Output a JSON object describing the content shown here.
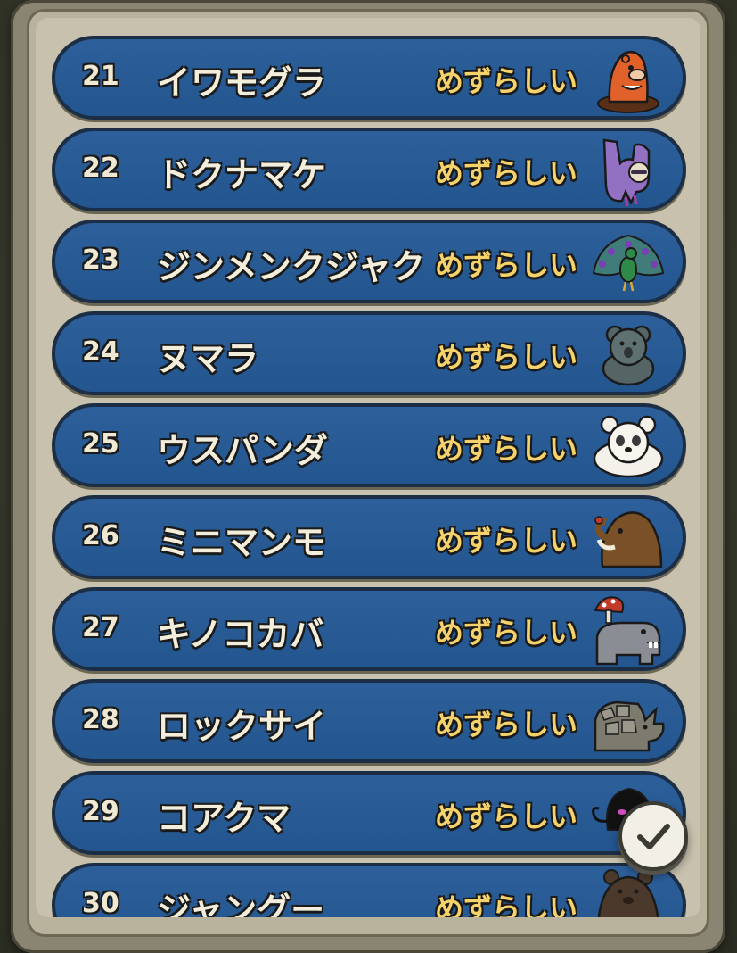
{
  "list": {
    "items": [
      {
        "number": "21",
        "name": "イワモグラ",
        "rarity": "めずらしい",
        "icon": "mole-icon"
      },
      {
        "number": "22",
        "name": "ドクナマケ",
        "rarity": "めずらしい",
        "icon": "sloth-icon"
      },
      {
        "number": "23",
        "name": "ジンメンクジャク",
        "rarity": "めずらしい",
        "icon": "peacock-icon"
      },
      {
        "number": "24",
        "name": "ヌマラ",
        "rarity": "めずらしい",
        "icon": "koala-icon"
      },
      {
        "number": "25",
        "name": "ウスパンダ",
        "rarity": "めずらしい",
        "icon": "panda-icon"
      },
      {
        "number": "26",
        "name": "ミニマンモ",
        "rarity": "めずらしい",
        "icon": "mammoth-icon"
      },
      {
        "number": "27",
        "name": "キノコカバ",
        "rarity": "めずらしい",
        "icon": "mushroom-hippo-icon"
      },
      {
        "number": "28",
        "name": "ロックサイ",
        "rarity": "めずらしい",
        "icon": "rock-rhino-icon"
      },
      {
        "number": "29",
        "name": "コアクマ",
        "rarity": "めずらしい",
        "icon": "imp-icon"
      },
      {
        "number": "30",
        "name": "ジャングー",
        "rarity": "めずらしい",
        "icon": "bear-icon"
      }
    ]
  },
  "confirm_button": {
    "icon": "checkmark-icon"
  },
  "colors": {
    "row_blue": "#2d5f9a",
    "rarity_yellow": "#f5d26a",
    "name_cream": "#f3eedb",
    "panel_frame": "#8a8573"
  }
}
